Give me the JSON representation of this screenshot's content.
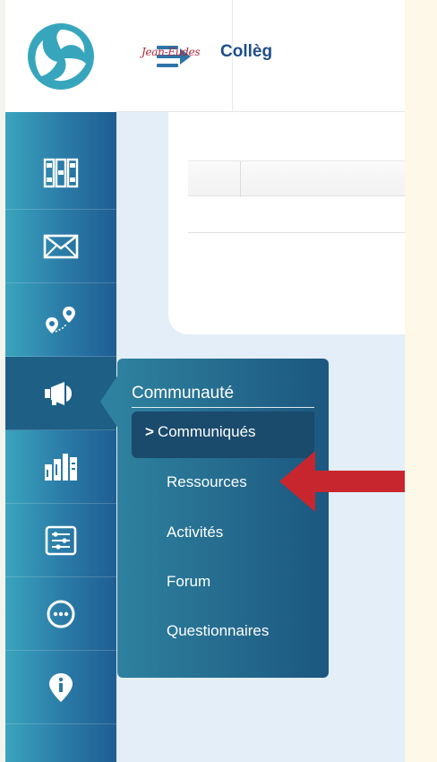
{
  "header": {
    "brand_script": "Jean-Eudes",
    "brand_name": "Collèg"
  },
  "sidebar": {
    "items": [
      {
        "icon": "grid-icon"
      },
      {
        "icon": "mail-icon"
      },
      {
        "icon": "map-pin-route-icon"
      },
      {
        "icon": "megaphone-icon",
        "active": true
      },
      {
        "icon": "bar-chart-icon"
      },
      {
        "icon": "sliders-icon"
      },
      {
        "icon": "chat-dots-icon"
      },
      {
        "icon": "info-icon"
      }
    ]
  },
  "submenu": {
    "title": "Communauté",
    "active_marker": ">",
    "items": [
      {
        "label": "Communiqués",
        "current": true
      },
      {
        "label": "Ressources"
      },
      {
        "label": "Activités"
      },
      {
        "label": "Forum"
      },
      {
        "label": "Questionnaires"
      }
    ]
  },
  "colors": {
    "sidebar_start": "#3aa4be",
    "sidebar_end": "#1f5e92",
    "brand_blue": "#1f4e86",
    "brand_red": "#b3263a",
    "arrow_red": "#c8262e",
    "background": "#e3eef8"
  }
}
